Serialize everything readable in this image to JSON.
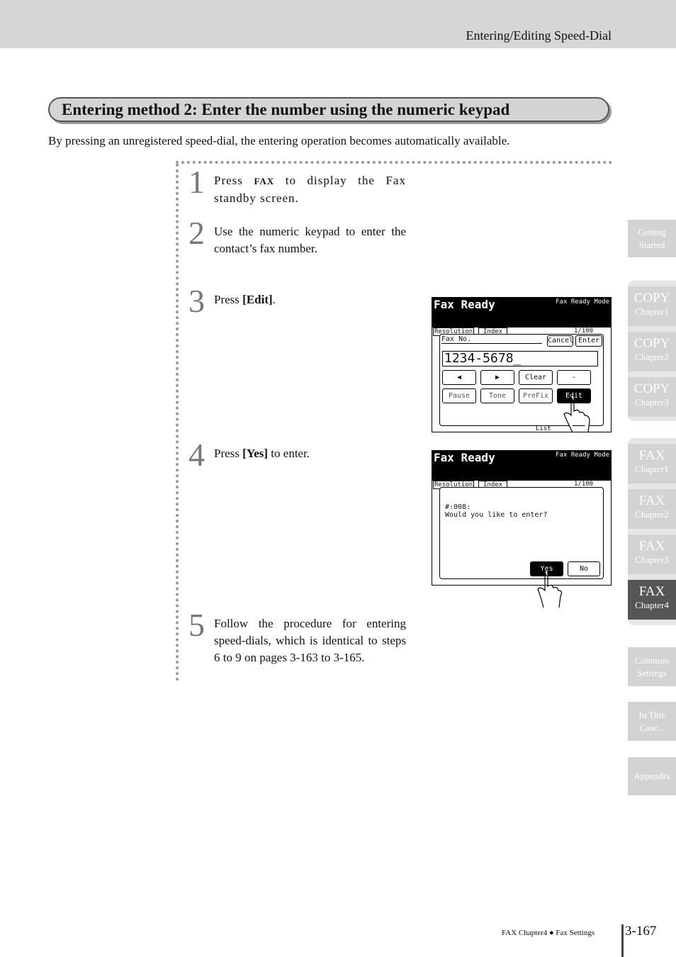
{
  "header": {
    "section": "Entering/Editing Speed-Dial"
  },
  "title": "Entering method 2: Enter the number using the numeric keypad",
  "intro": "By pressing an unregistered speed-dial, the entering operation becomes automatically available.",
  "steps": [
    {
      "num": "1",
      "pre": "Press ",
      "key": "FAX",
      "post": " to display the Fax standby screen."
    },
    {
      "num": "2",
      "text": "Use the numeric keypad to enter the contact’s fax number."
    },
    {
      "num": "3",
      "pre": "Press ",
      "key": "[Edit]",
      "post": "."
    },
    {
      "num": "4",
      "pre": "Press ",
      "key": "[Yes]",
      "post": " to enter."
    },
    {
      "num": "5",
      "text": "Follow the procedure for entering speed-dials, which is identical to steps 6 to 9 on pages 3-163 to 3-165."
    }
  ],
  "screen1": {
    "title": "Fax Ready",
    "mode": "Fax Ready Mode",
    "tab_resolution": "Resolution",
    "tab_index": "Index",
    "page": "1/100",
    "list": "List",
    "field_label": "Fax No.",
    "cancel": "Cancel",
    "enter": "Enter",
    "value": "1234-5678_",
    "left": "◀",
    "right": "▶",
    "clear": "Clear",
    "dash": "-",
    "pause": "Pause",
    "tone": "Tone",
    "prefix": "PreFix",
    "edit": "Edit"
  },
  "screen2": {
    "title": "Fax Ready",
    "mode": "Fax Ready Mode",
    "tab_resolution": "Resolution",
    "tab_index": "Index",
    "page": "1/100",
    "line1": "#:008:",
    "line2": "Would you like to enter?",
    "yes": "Yes",
    "no": "No"
  },
  "sidebar": [
    {
      "a": "Getting",
      "b": "Started"
    },
    {
      "a": "COPY",
      "b": "Chapter1"
    },
    {
      "a": "COPY",
      "b": "Chapter2"
    },
    {
      "a": "COPY",
      "b": "Chapter3"
    },
    {
      "a": "FAX",
      "b": "Chapter1"
    },
    {
      "a": "FAX",
      "b": "Chapter2"
    },
    {
      "a": "FAX",
      "b": "Chapter3"
    },
    {
      "a": "FAX",
      "b": "Chapter4",
      "active": true
    },
    {
      "a": "Common",
      "b": "Settings"
    },
    {
      "a": "In This",
      "b": "Case..."
    },
    {
      "a": "Appendix"
    }
  ],
  "footer": {
    "chapter": "FAX Chapter4",
    "bullet": "●",
    "section": "Fax Settings",
    "page": "3-167"
  }
}
